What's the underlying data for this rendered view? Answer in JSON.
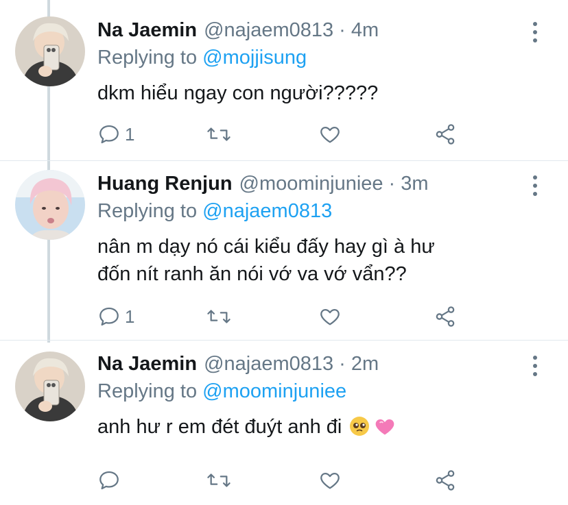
{
  "tweets": [
    {
      "name": "Na Jaemin",
      "handle": "@najaem0813",
      "dot": "·",
      "time": "4m",
      "replying_prefix": "Replying to",
      "replying_to": "@mojjisung",
      "text": "dkm hiểu ngay con người?????",
      "reply_count": "1",
      "avatar_icon": "avatar-photo"
    },
    {
      "name": "Huang Renjun",
      "handle": "@moominjuniee",
      "dot": "·",
      "time": "3m",
      "replying_prefix": "Replying to",
      "replying_to": "@najaem0813",
      "text_line1": "nân m dạy nó cái kiểu đấy hay gì à hư",
      "text_line2": "đốn nít ranh ăn nói vớ va vớ vẩn??",
      "reply_count": "1",
      "avatar_icon": "avatar-photo"
    },
    {
      "name": "Na Jaemin",
      "handle": "@najaem0813",
      "dot": "·",
      "time": "2m",
      "replying_prefix": "Replying to",
      "replying_to": "@moominjuniee",
      "text": "anh hư r em đét đuýt anh đi",
      "emoji_icons": [
        "pleading-face-icon",
        "pink-heart-icon"
      ],
      "reply_count": "",
      "avatar_icon": "avatar-photo"
    }
  ],
  "colors": {
    "link": "#1da1f2",
    "muted": "#657786",
    "text": "#14171a",
    "divider": "#e1e8ed",
    "thread_line": "#cfd9de"
  }
}
